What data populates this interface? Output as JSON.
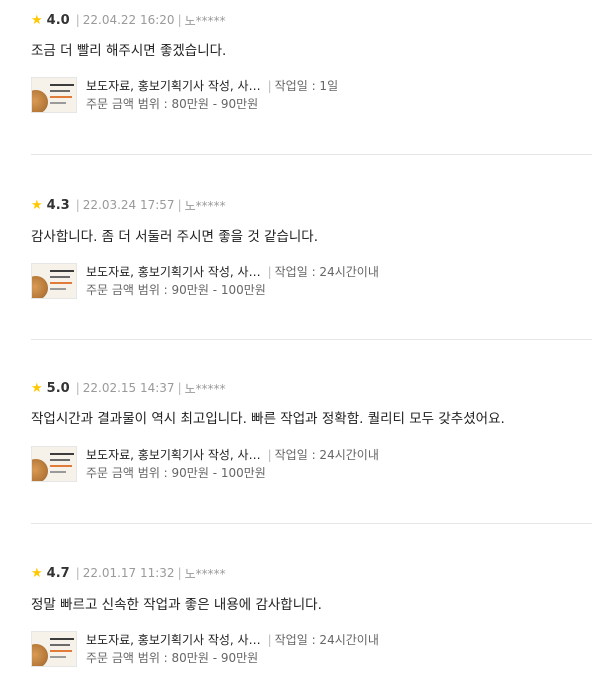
{
  "reviews": [
    {
      "score": "4.0",
      "date": "22.04.22 16:20",
      "author": "노*****",
      "text": "조금 더 빨리 해주시면 좋겠습니다.",
      "product_title": "보도자료, 홍보기획기사 작성, 사…",
      "work_days": "작업일 : 1일",
      "price_range": "주문 금액 범위 : 80만원 - 90만원"
    },
    {
      "score": "4.3",
      "date": "22.03.24 17:57",
      "author": "노*****",
      "text": "감사합니다. 좀 더 서둘러 주시면 좋을 것 같습니다.",
      "product_title": "보도자료, 홍보기획기사 작성, 사…",
      "work_days": "작업일 : 24시간이내",
      "price_range": "주문 금액 범위 : 90만원 - 100만원"
    },
    {
      "score": "5.0",
      "date": "22.02.15 14:37",
      "author": "노*****",
      "text": "작업시간과 결과물이 역시 최고입니다. 빠른 작업과 정확함. 퀄리티 모두 갖추셨어요.",
      "product_title": "보도자료, 홍보기획기사 작성, 사…",
      "work_days": "작업일 : 24시간이내",
      "price_range": "주문 금액 범위 : 90만원 - 100만원"
    },
    {
      "score": "4.7",
      "date": "22.01.17 11:32",
      "author": "노*****",
      "text": "정말 빠르고 신속한 작업과 좋은 내용에 감사합니다.",
      "product_title": "보도자료, 홍보기획기사 작성, 사…",
      "work_days": "작업일 : 24시간이내",
      "price_range": "주문 금액 범위 : 80만원 - 90만원"
    }
  ],
  "icons": {
    "star": "star-icon",
    "thumbnail": "product-thumbnail"
  },
  "colors": {
    "star": "#ffc800",
    "muted": "#9a9a9a",
    "divider": "#e5e5e5"
  }
}
